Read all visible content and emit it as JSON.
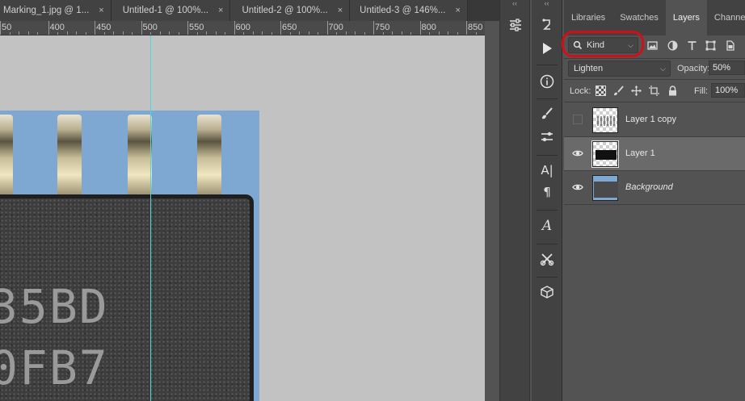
{
  "document_tabs": [
    {
      "label": "Marking_1.jpg @ 1...",
      "close": "×"
    },
    {
      "label": "Untitled-1 @ 100%...",
      "close": "×"
    },
    {
      "label": "Untitled-2 @ 100%...",
      "close": "×"
    },
    {
      "label": "Untitled-3 @ 146%...",
      "close": "×"
    }
  ],
  "ruler": {
    "labels": [
      "50",
      "400",
      "450",
      "500",
      "550",
      "600",
      "650",
      "700",
      "750",
      "800",
      "850"
    ]
  },
  "canvas": {
    "chip_marking_lines": [
      "35BD",
      "0FB7"
    ]
  },
  "tools": {
    "collapse_left": "‹‹",
    "collapse_right": "‹‹"
  },
  "panel": {
    "tabs": [
      "Libraries",
      "Swatches",
      "Layers",
      "Channels"
    ],
    "active_tab": "Layers",
    "filter": {
      "value": "Kind"
    },
    "blend_mode": "Lighten",
    "opacity_label": "Opacity:",
    "opacity_value": "50%",
    "lock_label": "Lock:",
    "fill_label": "Fill:",
    "fill_value": "100%",
    "layers": [
      {
        "name": "Layer 1 copy",
        "visible": false,
        "selected": false,
        "italic": false
      },
      {
        "name": "Layer 1",
        "visible": true,
        "selected": true,
        "italic": false
      },
      {
        "name": "Background",
        "visible": true,
        "selected": false,
        "italic": true
      }
    ]
  },
  "colors": {
    "highlight": "#d10f18",
    "guide": "#47d8e0",
    "photo_bg": "#7ea8d1"
  }
}
